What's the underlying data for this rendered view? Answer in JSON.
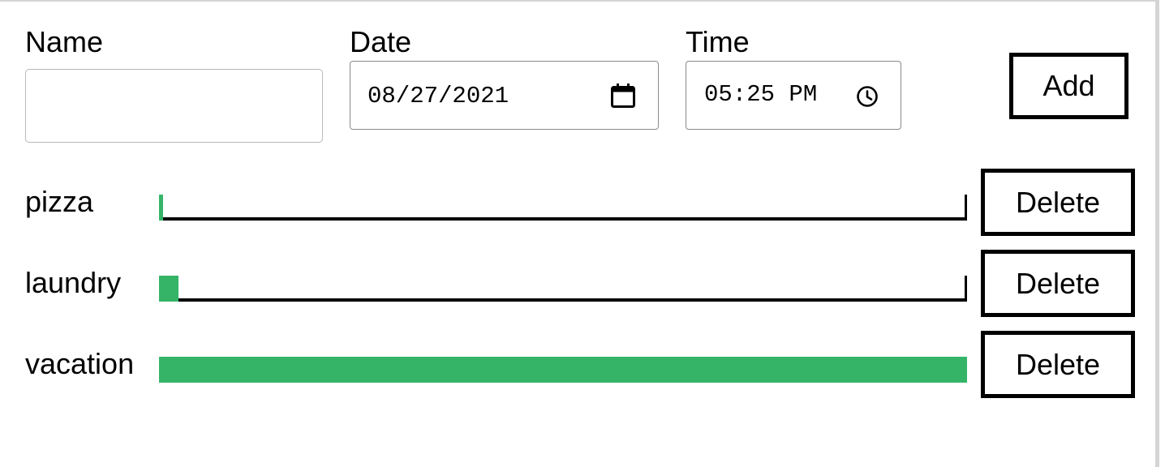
{
  "form": {
    "name_label": "Name",
    "name_value": "",
    "date_label": "Date",
    "date_value": "08/27/2021",
    "time_label": "Time",
    "time_value": "05:25 PM",
    "add_label": "Add"
  },
  "colors": {
    "progress_fill": "#35b468"
  },
  "tasks": [
    {
      "name": "pizza",
      "progress": 0.005,
      "delete_label": "Delete"
    },
    {
      "name": "laundry",
      "progress": 0.024,
      "delete_label": "Delete"
    },
    {
      "name": "vacation",
      "progress": 1.0,
      "delete_label": "Delete"
    }
  ]
}
